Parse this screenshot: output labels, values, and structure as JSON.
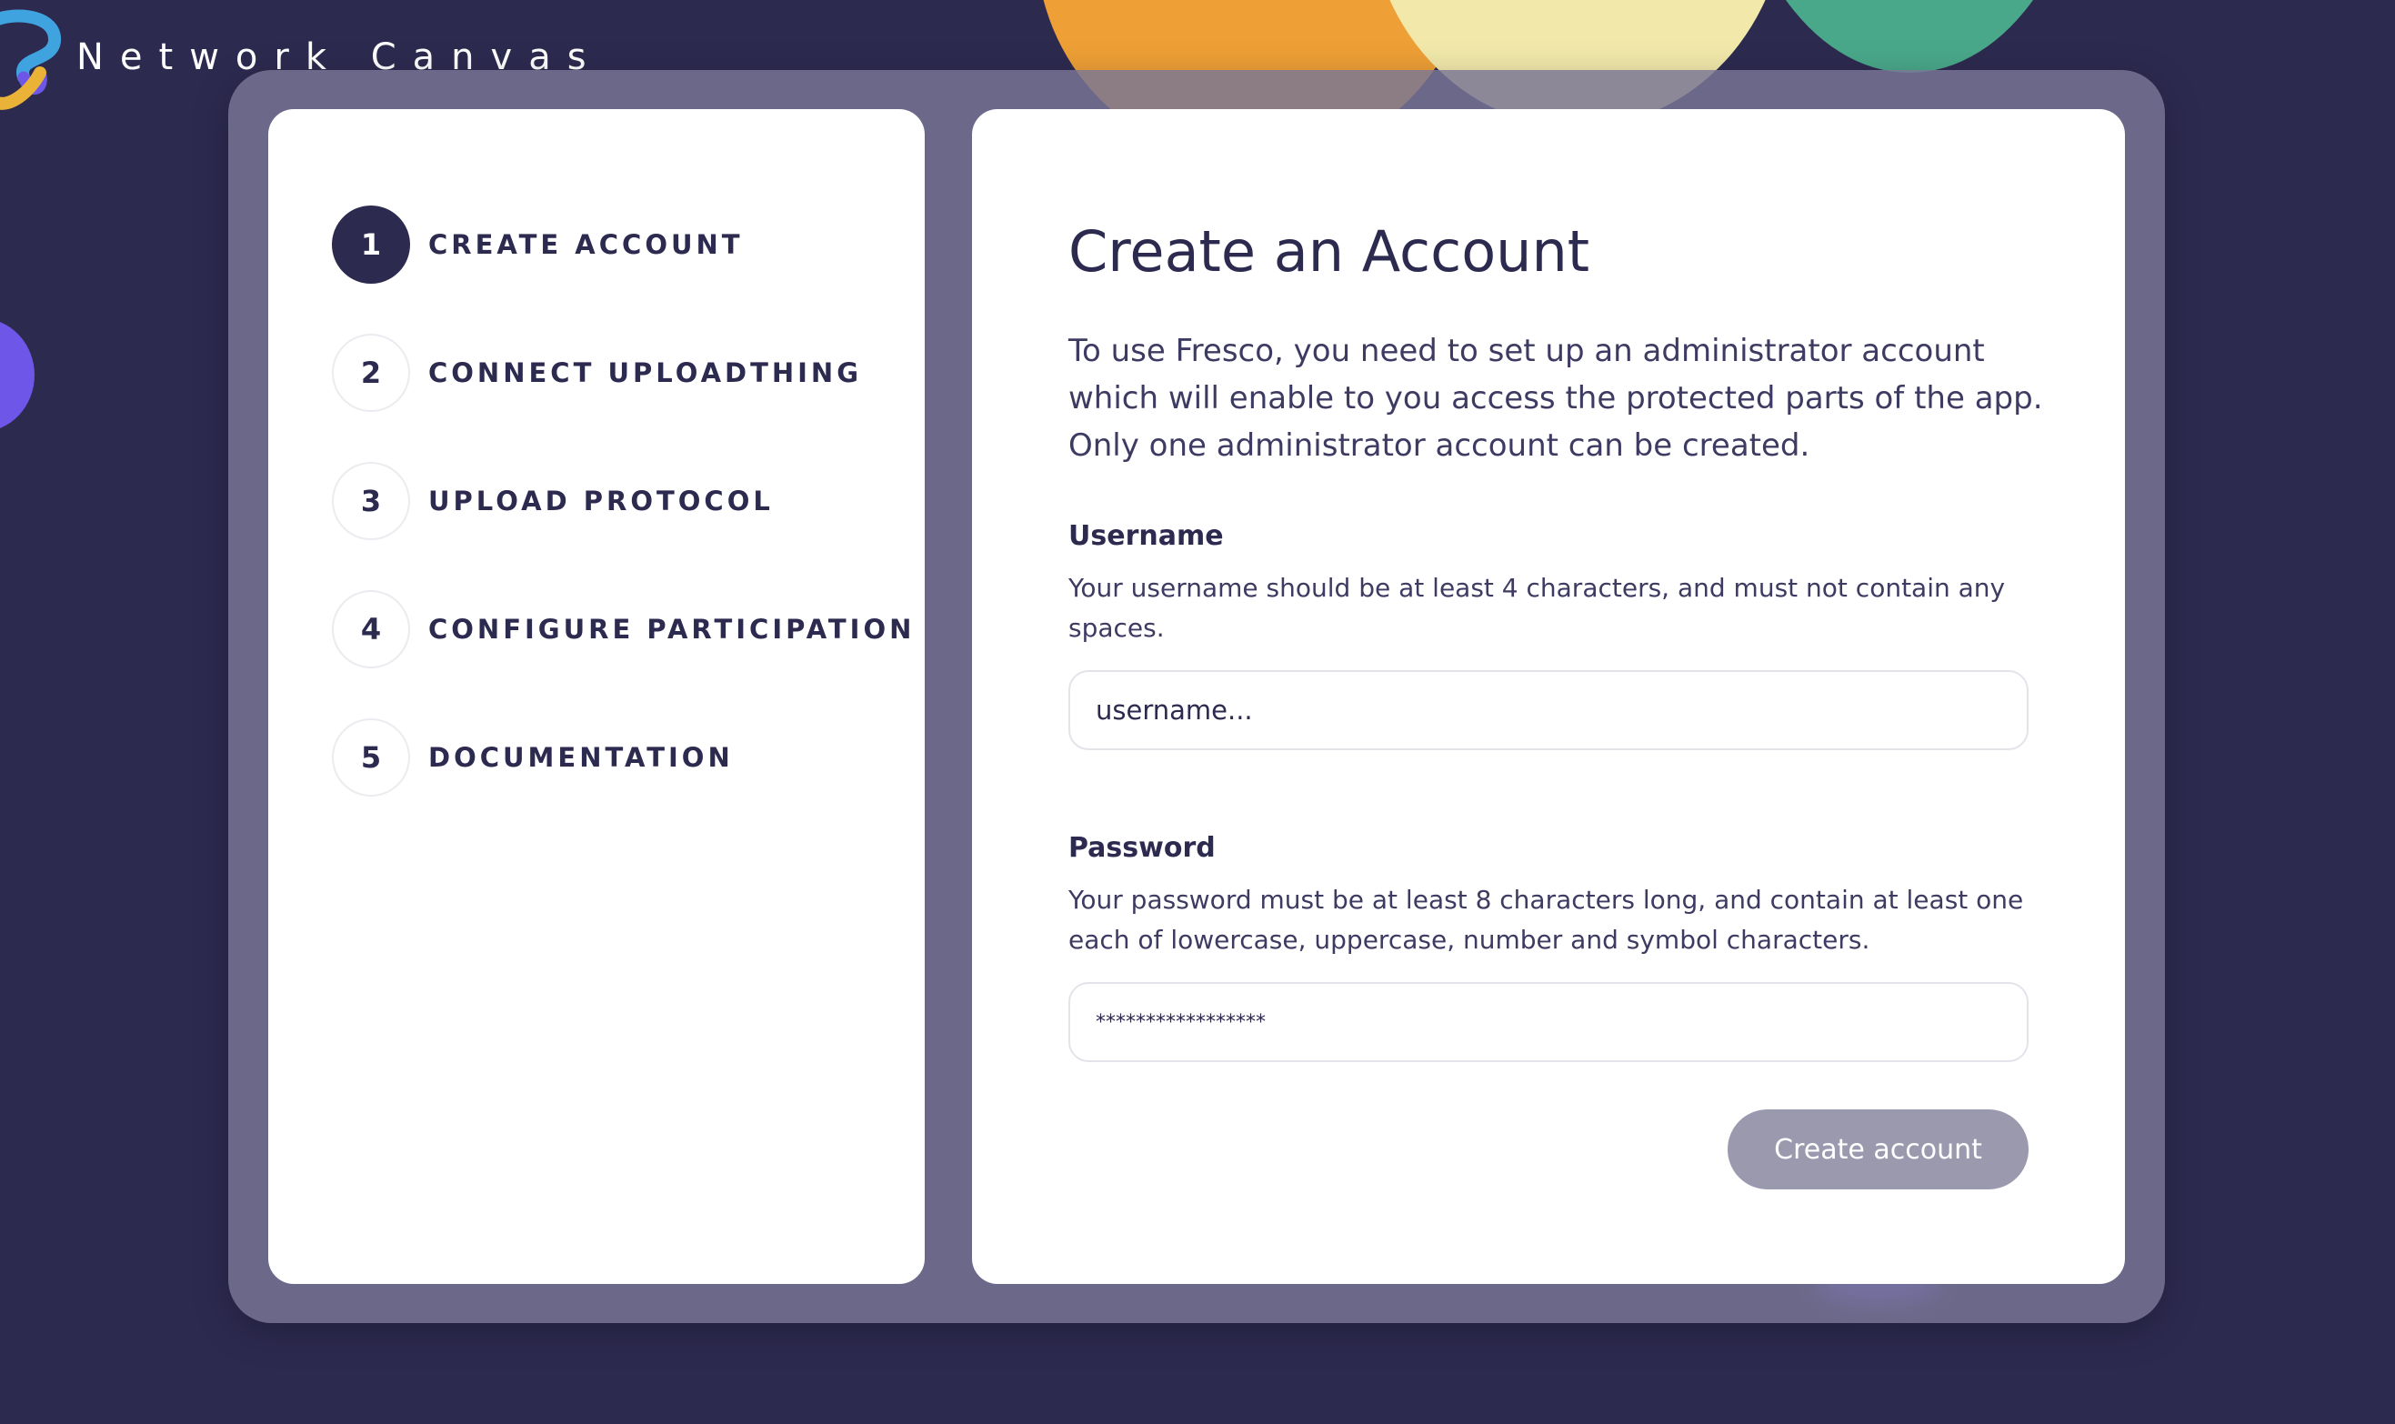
{
  "brand": {
    "name": "Network Canvas"
  },
  "steps": [
    {
      "number": "1",
      "label": "CREATE ACCOUNT",
      "active": true
    },
    {
      "number": "2",
      "label": "CONNECT UPLOADTHING",
      "active": false
    },
    {
      "number": "3",
      "label": "UPLOAD PROTOCOL",
      "active": false
    },
    {
      "number": "4",
      "label": "CONFIGURE PARTICIPATION",
      "active": false
    },
    {
      "number": "5",
      "label": "DOCUMENTATION",
      "active": false
    }
  ],
  "form": {
    "title": "Create an Account",
    "intro": "To use Fresco, you need to set up an administrator account which will enable to you access the protected parts of the app. Only one administrator account can be created.",
    "username": {
      "label": "Username",
      "hint": "Your username should be at least 4 characters, and must not contain any spaces.",
      "placeholder": "username..."
    },
    "password": {
      "label": "Password",
      "hint": "Your password must be at least 8 characters long, and contain at least one each of lowercase, uppercase, number and symbol characters.",
      "placeholder": "*****************"
    },
    "submit_label": "Create account"
  },
  "colors": {
    "background": "#2d2a50",
    "frame": "#787594",
    "active_step": "#2d2a50",
    "button_disabled": "#9b99ae"
  }
}
